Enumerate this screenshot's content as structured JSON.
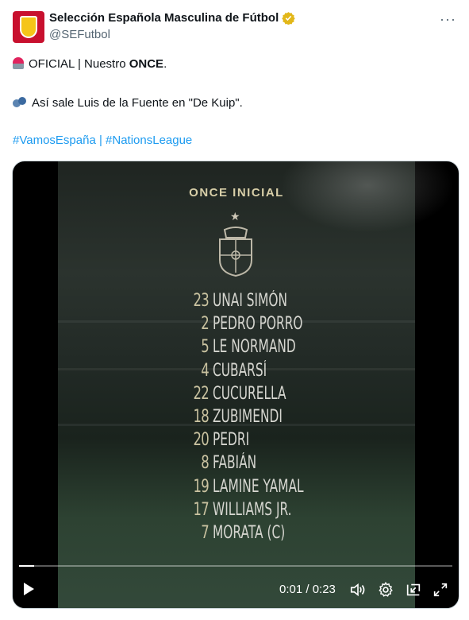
{
  "tweet": {
    "display_name": "Selección Española Masculina de Fútbol",
    "handle": "@SEFutbol",
    "line1_prefix": "OFICIAL | Nuestro ",
    "line1_bold": "ONCE",
    "line1_suffix": ".",
    "line2": "Así sale Luis de la Fuente en \"De Kuip\".",
    "hashtags": "#VamosEspaña | #NationsLeague"
  },
  "video": {
    "title": "ONCE INICIAL",
    "players": [
      {
        "number": "23",
        "name": "UNAI SIMÓN"
      },
      {
        "number": "2",
        "name": "PEDRO PORRO"
      },
      {
        "number": "5",
        "name": "LE NORMAND"
      },
      {
        "number": "4",
        "name": "CUBARSÍ"
      },
      {
        "number": "22",
        "name": "CUCURELLA"
      },
      {
        "number": "18",
        "name": "ZUBIMENDI"
      },
      {
        "number": "20",
        "name": "PEDRI"
      },
      {
        "number": "8",
        "name": "FABIÁN"
      },
      {
        "number": "19",
        "name": "LAMINE YAMAL"
      },
      {
        "number": "17",
        "name": "WILLIAMS JR."
      },
      {
        "number": "7",
        "name": "MORATA (C)"
      }
    ],
    "time_display": "0:01 / 0:23",
    "progress_fraction": 0.035
  },
  "icons": {
    "verified": "verified-badge-icon",
    "more": "more-icon",
    "play": "play-icon",
    "volume": "volume-icon",
    "settings": "gear-icon",
    "pip": "pip-icon",
    "fullscreen": "fullscreen-icon"
  },
  "colors": {
    "link": "#1d9bf0",
    "verified_gold": "#e2b719",
    "brand_red": "#c8102e"
  }
}
